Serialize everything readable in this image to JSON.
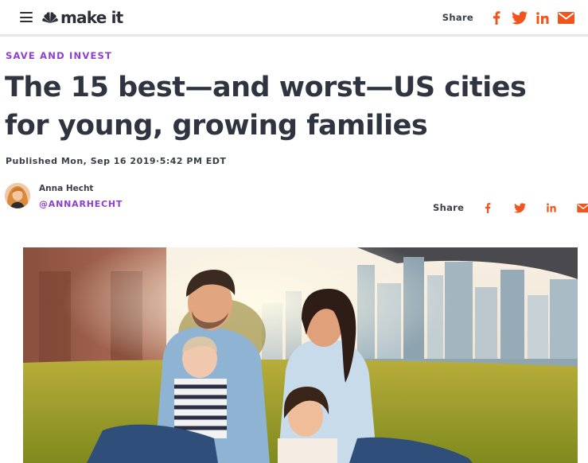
{
  "nav": {
    "menu_icon": "hamburger-menu-icon",
    "logo_icon": "peacock-icon",
    "logo_text": "make it",
    "share_label": "Share",
    "social_icons": [
      "facebook-icon",
      "twitter-icon",
      "linkedin-icon",
      "email-icon"
    ]
  },
  "article": {
    "eyebrow": "SAVE AND INVEST",
    "headline": "The 15 best—and worst—US cities for young, growing families",
    "published": "Published Mon, Sep 16 2019·5:42 PM EDT",
    "author": {
      "name": "Anna Hecht",
      "handle": "@ANNARHECHT"
    },
    "share_label": "Share",
    "hero_image": "family-park-city-skyline-photo"
  },
  "colors": {
    "accent_purple": "#8e3fd1",
    "social_orange": "#f2541b",
    "text_dark": "#2f3540"
  }
}
